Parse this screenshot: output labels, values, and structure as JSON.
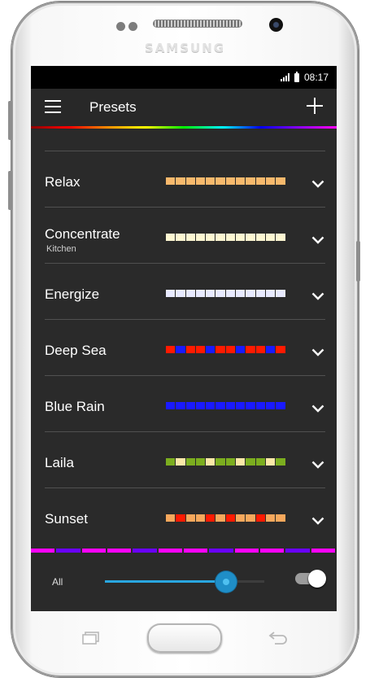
{
  "device": {
    "brand": "SAMSUNG"
  },
  "status_bar": {
    "time": "08:17",
    "icons": [
      "signal-icon",
      "battery-icon"
    ]
  },
  "app_bar": {
    "title": "Presets",
    "left_icon": "menu-icon",
    "right_icon": "plus-icon"
  },
  "presets": [
    {
      "name": "Relax",
      "subtitle": "",
      "colors": [
        "#f7b96c",
        "#f7b96c",
        "#f7b96c",
        "#f7b96c",
        "#f7b96c",
        "#f7b96c",
        "#f7b96c",
        "#f7b96c",
        "#f7b96c",
        "#f7b96c",
        "#f7b96c",
        "#f7b96c"
      ]
    },
    {
      "name": "Concentrate",
      "subtitle": "Kitchen",
      "colors": [
        "#fdf7d2",
        "#fdf7d2",
        "#fdf7d2",
        "#fdf7d2",
        "#fdf7d2",
        "#fdf7d2",
        "#fdf7d2",
        "#fdf7d2",
        "#fdf7d2",
        "#fdf7d2",
        "#fdf7d2",
        "#fdf7d2"
      ]
    },
    {
      "name": "Energize",
      "subtitle": "",
      "colors": [
        "#e8eaff",
        "#e8eaff",
        "#e8eaff",
        "#e8eaff",
        "#e8eaff",
        "#e8eaff",
        "#e8eaff",
        "#e8eaff",
        "#e8eaff",
        "#e8eaff",
        "#e8eaff",
        "#e8eaff"
      ]
    },
    {
      "name": "Deep Sea",
      "subtitle": "",
      "colors": [
        "#ff1a00",
        "#1a1aff",
        "#ff1a00",
        "#ff1a00",
        "#1a1aff",
        "#ff1a00",
        "#ff1a00",
        "#1a1aff",
        "#ff1a00",
        "#ff1a00",
        "#1a1aff",
        "#ff1a00"
      ]
    },
    {
      "name": "Blue Rain",
      "subtitle": "",
      "colors": [
        "#1a1aff",
        "#1a1aff",
        "#1a1aff",
        "#1a1aff",
        "#1a1aff",
        "#1a1aff",
        "#1a1aff",
        "#1a1aff",
        "#1a1aff",
        "#1a1aff",
        "#1a1aff",
        "#1a1aff"
      ]
    },
    {
      "name": "Laila",
      "subtitle": "",
      "colors": [
        "#7cae1f",
        "#fbe8a8",
        "#7cae1f",
        "#7cae1f",
        "#fbe8a8",
        "#7cae1f",
        "#7cae1f",
        "#fbe8a8",
        "#7cae1f",
        "#7cae1f",
        "#fbe8a8",
        "#7cae1f"
      ]
    },
    {
      "name": "Sunset",
      "subtitle": "",
      "colors": [
        "#f7a85c",
        "#ff1a00",
        "#f7a85c",
        "#f7a85c",
        "#ff1a00",
        "#f7a85c",
        "#ff1a00",
        "#f7a85c",
        "#f7a85c",
        "#ff1a00",
        "#f7a85c",
        "#f7a85c"
      ]
    }
  ],
  "current_color_bar": [
    "#ff00ff",
    "#6a00ff",
    "#ff00ff",
    "#ff00ff",
    "#6a00ff",
    "#ff00ff",
    "#ff00ff",
    "#6a00ff",
    "#ff00ff",
    "#ff00ff",
    "#6a00ff",
    "#ff00ff"
  ],
  "bottom_bar": {
    "label": "All",
    "brightness": 0.76,
    "power_on": true
  },
  "accent_colors": {
    "slider": "#29a6e0",
    "chevron": "#ffffff",
    "rainbow": [
      "#ff0000",
      "#ffff00",
      "#00ff00",
      "#00ffff",
      "#0000ff",
      "#ff00ff"
    ]
  },
  "hardware_icons": [
    "recent-apps-icon",
    "home-button",
    "back-icon"
  ]
}
